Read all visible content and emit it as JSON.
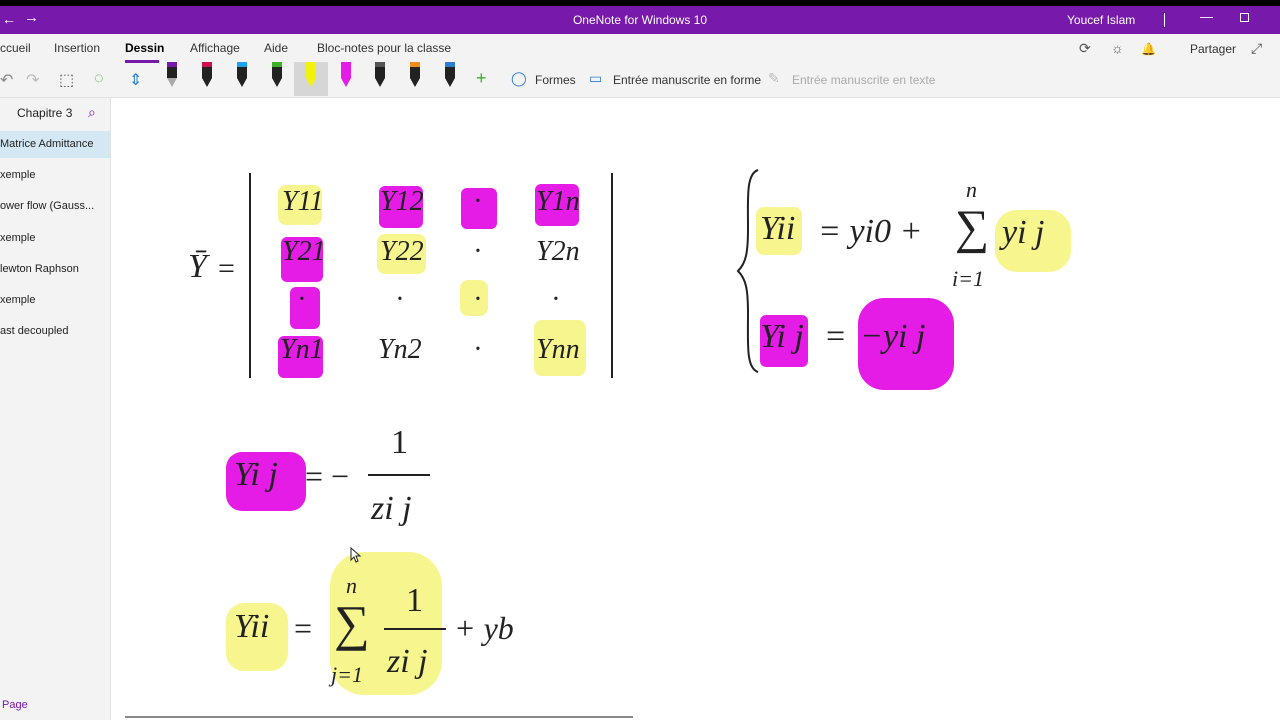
{
  "titlebar": {
    "back_icon": "←",
    "forward_icon": "→",
    "title": "OneNote for Windows 10",
    "user": "Youcef Islam",
    "minimize_icon": "—"
  },
  "ribbon": {
    "tabs": [
      {
        "label": "ccueil"
      },
      {
        "label": "Insertion"
      },
      {
        "label": "Dessin"
      },
      {
        "label": "Affichage"
      },
      {
        "label": "Aide"
      },
      {
        "label": "Bloc-notes pour la classe"
      }
    ],
    "active_tab": "Dessin",
    "share_label": "Partager",
    "sync_icon": "⟳",
    "idea_icon": "☼",
    "bell_icon": "🔔",
    "expand_icon": "⤢"
  },
  "toolbar": {
    "undo_icon": "↶",
    "redo_icon": "↷",
    "lasso_icon": "⬚",
    "eraser_icon": "◌",
    "space_icon": "⇕",
    "add_pen_icon": "+",
    "shapes_label": "Formes",
    "ink_to_shape_label": "Entrée manuscrite en forme",
    "ink_to_text_label": "Entrée manuscrite en texte",
    "pen_colors": [
      "#7719aa",
      "#d0104c",
      "#1ea1f2",
      "#3cb028",
      "#f2f20d",
      "#e41ce6",
      "#555555",
      "#f28c1b",
      "#2b7ed1"
    ]
  },
  "sidebar": {
    "section": "Chapitre 3",
    "search_icon": "⌕",
    "pages": [
      {
        "label": "Matrice Admittance"
      },
      {
        "label": "xemple"
      },
      {
        "label": "ower flow (Gauss..."
      },
      {
        "label": "xemple"
      },
      {
        "label": "lewton Raphson"
      },
      {
        "label": "xemple"
      },
      {
        "label": "ast decoupled"
      }
    ],
    "add_page_label": "Page"
  },
  "canvas": {
    "eq_matrix": {
      "lhs": "Ȳ",
      "equals": "=",
      "cells": [
        [
          "Y11",
          "Y12",
          "·",
          "Y1n"
        ],
        [
          "Y21",
          "Y22",
          "·",
          "Y2n"
        ],
        [
          "·",
          "·",
          "·",
          "·"
        ],
        [
          "Yn1",
          "Yn2",
          "·",
          "Ynn"
        ]
      ]
    },
    "eq_system": {
      "line1_lhs": "Yii",
      "line1_rhs": "= yi0 + ",
      "sum_top": "n",
      "sum_bottom": "i=1",
      "sum_term": "yi j",
      "line2_lhs": "Yi j",
      "line2_eq": "=",
      "line2_rhs": "−yi j"
    },
    "eq_yij": {
      "lhs": "Yi j",
      "rhs": "= −",
      "numerator": "1",
      "denominator": "zi j"
    },
    "eq_yii": {
      "lhs": "Yii",
      "equals": "=",
      "sum_top": "n",
      "sum_bottom": "j=1",
      "numerator": "1",
      "denominator": "zi j",
      "tail": "+ yb"
    }
  }
}
